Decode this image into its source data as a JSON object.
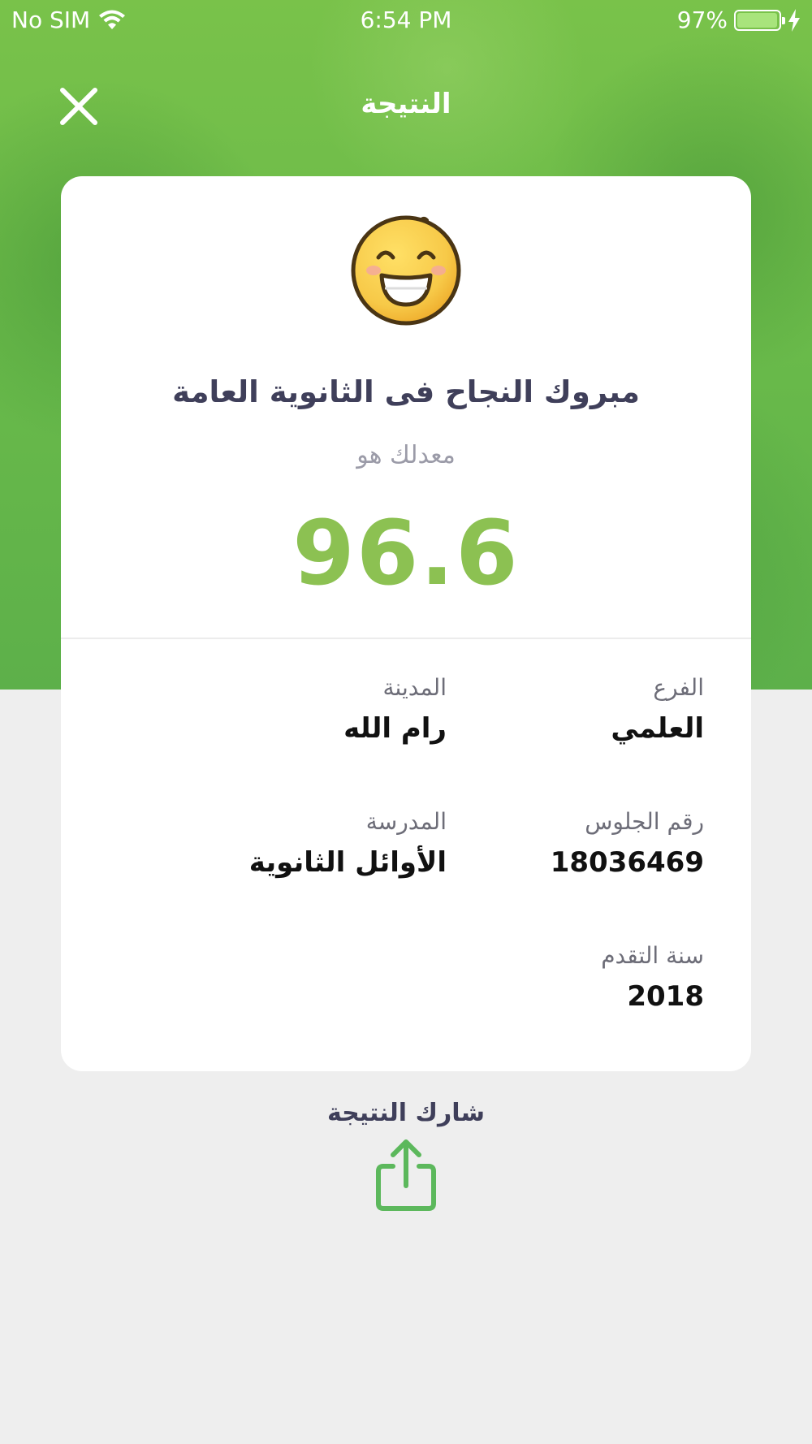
{
  "status_bar": {
    "carrier": "No SIM",
    "time": "6:54 PM",
    "battery": "97%",
    "battery_level": 0.97,
    "icons": [
      "wifi-icon",
      "battery-icon",
      "charging-bolt-icon"
    ]
  },
  "nav": {
    "title": "النتيجة",
    "close_icon": "close-icon"
  },
  "result": {
    "emoji_icon": "grinning-face-icon",
    "congrats": "مبروك النجاح فى الثانوية العامة",
    "average_label": "معدلك هو",
    "average_value": "96.6"
  },
  "details": {
    "branch_label": "الفرع",
    "branch_value": "العلمي",
    "city_label": "المدينة",
    "city_value": "رام الله",
    "seat_label": "رقم الجلوس",
    "seat_value": "18036469",
    "school_label": "المدرسة",
    "school_value": "الأوائل الثانوية",
    "year_label": "سنة التقدم",
    "year_value": "2018"
  },
  "share": {
    "label": "شارك النتيجة",
    "icon": "share-icon"
  },
  "colors": {
    "accent_green": "#8cc152",
    "share_green": "#5cb85c",
    "title_text": "#3f3f5a",
    "page_bg": "#eeeeee"
  }
}
